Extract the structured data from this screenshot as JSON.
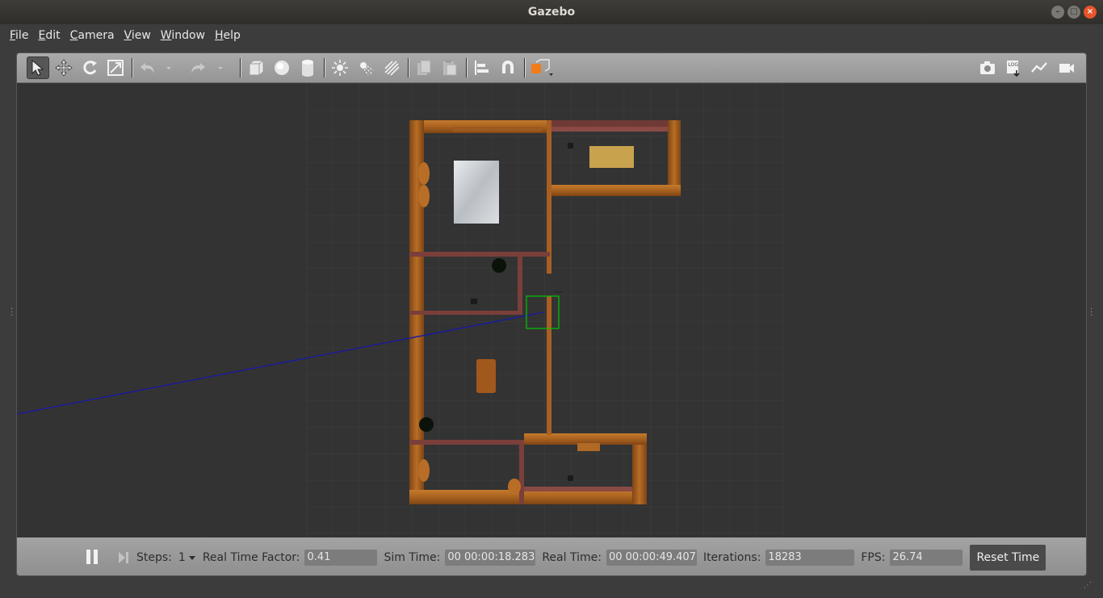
{
  "window": {
    "title": "Gazebo"
  },
  "menu": [
    {
      "label": "File"
    },
    {
      "label": "Edit"
    },
    {
      "label": "Camera"
    },
    {
      "label": "View"
    },
    {
      "label": "Window"
    },
    {
      "label": "Help"
    }
  ],
  "bottom": {
    "steps_label": "Steps:",
    "steps_value": "1",
    "rtf_label": "Real Time Factor:",
    "rtf_value": "0.41",
    "sim_label": "Sim Time:",
    "sim_value": "00 00:00:18.283",
    "real_label": "Real Time:",
    "real_value": "00 00:00:49.407",
    "iter_label": "Iterations:",
    "iter_value": "18283",
    "fps_label": "FPS:",
    "fps_value": "26.74",
    "reset_label": "Reset Time"
  },
  "colors": {
    "wood": "#a8611f",
    "selection": "#00c800",
    "ray": "#1a1aa0",
    "accent": "#f07d1a"
  }
}
